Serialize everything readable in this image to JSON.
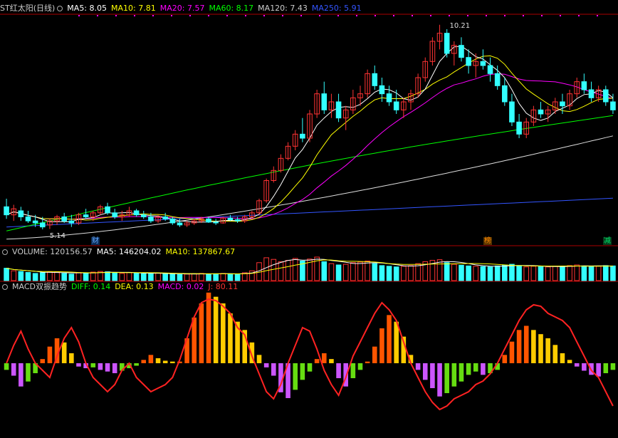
{
  "header": {
    "name": "ST红太阳(日线)",
    "ma": [
      {
        "label": "MA5: 8.05",
        "color": "#ffffff"
      },
      {
        "label": "MA10: 7.81",
        "color": "#ffff00"
      },
      {
        "label": "MA20: 7.57",
        "color": "#ff00ff"
      },
      {
        "label": "MA60: 8.17",
        "color": "#00ff00"
      },
      {
        "label": "MA120: 7.43",
        "color": "#cccccc"
      },
      {
        "label": "MA250: 5.91",
        "color": "#3355ff"
      }
    ]
  },
  "volume_header": {
    "items": [
      {
        "label": "VOLUME: 120156.57",
        "color": "#cccccc"
      },
      {
        "label": "MA5: 146204.02",
        "color": "#ffffff"
      },
      {
        "label": "MA10: 137867.67",
        "color": "#ffff00"
      }
    ]
  },
  "macd_header": {
    "items": [
      {
        "label": "MACD双振趋势",
        "color": "#cccccc"
      },
      {
        "label": "DIFF: 0.14",
        "color": "#00ff00"
      },
      {
        "label": "DEA: 0.13",
        "color": "#ffff00"
      },
      {
        "label": "MACD: 0.02",
        "color": "#ff00ff"
      },
      {
        "label": "J: 80.11",
        "color": "#ff3333"
      }
    ]
  },
  "annotations": {
    "high_label": "10.21",
    "low_label": "5.14",
    "flags": [
      {
        "text": "财",
        "color": "#66aaff",
        "bg": "#0a2a55"
      },
      {
        "text": "榜",
        "color": "#ff8800",
        "bg": "#553300"
      },
      {
        "text": "减",
        "color": "#00dd66",
        "bg": "#063d1c"
      }
    ]
  },
  "colors": {
    "up": "#ff3333",
    "down": "#33ffff",
    "ma5": "#ffffff",
    "ma10": "#ffff00",
    "ma20": "#ff00ff",
    "ma60": "#00ff00",
    "ma120": "#dddddd",
    "ma250": "#3355ff",
    "frame": "#aa0000"
  },
  "chart_data": {
    "type": "candlestick",
    "price_range": [
      5.0,
      10.4
    ],
    "ohlc": [
      [
        5.7,
        5.9,
        5.4,
        5.5
      ],
      [
        5.5,
        5.75,
        5.35,
        5.65
      ],
      [
        5.6,
        5.7,
        5.35,
        5.45
      ],
      [
        5.45,
        5.6,
        5.3,
        5.35
      ],
      [
        5.35,
        5.5,
        5.2,
        5.3
      ],
      [
        5.3,
        5.45,
        5.14,
        5.2
      ],
      [
        5.25,
        5.4,
        5.15,
        5.35
      ],
      [
        5.35,
        5.5,
        5.25,
        5.45
      ],
      [
        5.45,
        5.55,
        5.3,
        5.35
      ],
      [
        5.35,
        5.5,
        5.2,
        5.3
      ],
      [
        5.3,
        5.55,
        5.25,
        5.5
      ],
      [
        5.5,
        5.65,
        5.4,
        5.45
      ],
      [
        5.45,
        5.6,
        5.35,
        5.55
      ],
      [
        5.55,
        5.75,
        5.5,
        5.7
      ],
      [
        5.7,
        5.8,
        5.5,
        5.55
      ],
      [
        5.55,
        5.65,
        5.4,
        5.45
      ],
      [
        5.45,
        5.6,
        5.35,
        5.5
      ],
      [
        5.5,
        5.7,
        5.45,
        5.6
      ],
      [
        5.6,
        5.65,
        5.45,
        5.5
      ],
      [
        5.5,
        5.6,
        5.4,
        5.45
      ],
      [
        5.45,
        5.55,
        5.3,
        5.35
      ],
      [
        5.35,
        5.5,
        5.3,
        5.45
      ],
      [
        5.45,
        5.55,
        5.35,
        5.4
      ],
      [
        5.4,
        5.45,
        5.25,
        5.3
      ],
      [
        5.3,
        5.4,
        5.2,
        5.25
      ],
      [
        5.25,
        5.35,
        5.2,
        5.3
      ],
      [
        5.3,
        5.4,
        5.25,
        5.35
      ],
      [
        5.35,
        5.45,
        5.3,
        5.4
      ],
      [
        5.4,
        5.45,
        5.3,
        5.32
      ],
      [
        5.32,
        5.4,
        5.25,
        5.3
      ],
      [
        5.3,
        5.45,
        5.28,
        5.42
      ],
      [
        5.42,
        5.5,
        5.35,
        5.38
      ],
      [
        5.38,
        5.45,
        5.3,
        5.35
      ],
      [
        5.35,
        5.5,
        5.3,
        5.45
      ],
      [
        5.45,
        5.6,
        5.4,
        5.55
      ],
      [
        5.55,
        5.9,
        5.5,
        5.85
      ],
      [
        5.85,
        6.4,
        5.8,
        6.35
      ],
      [
        6.35,
        6.7,
        6.3,
        6.6
      ],
      [
        6.6,
        7.0,
        6.55,
        6.9
      ],
      [
        6.9,
        7.3,
        6.85,
        7.2
      ],
      [
        7.2,
        7.6,
        7.1,
        7.5
      ],
      [
        7.5,
        7.9,
        7.3,
        7.4
      ],
      [
        7.4,
        8.1,
        7.3,
        8.0
      ],
      [
        8.0,
        8.6,
        7.9,
        8.5
      ],
      [
        8.5,
        8.8,
        8.0,
        8.1
      ],
      [
        8.1,
        8.5,
        7.9,
        8.3
      ],
      [
        8.3,
        8.5,
        7.8,
        7.9
      ],
      [
        7.9,
        8.2,
        7.6,
        8.1
      ],
      [
        8.1,
        8.6,
        8.0,
        8.4
      ],
      [
        8.4,
        8.7,
        8.2,
        8.5
      ],
      [
        8.5,
        9.1,
        8.4,
        9.0
      ],
      [
        9.0,
        9.2,
        8.6,
        8.7
      ],
      [
        8.7,
        8.9,
        8.3,
        8.5
      ],
      [
        8.5,
        8.7,
        8.2,
        8.3
      ],
      [
        8.3,
        8.6,
        8.0,
        8.1
      ],
      [
        8.1,
        8.4,
        7.9,
        8.3
      ],
      [
        8.3,
        8.6,
        8.1,
        8.5
      ],
      [
        8.5,
        9.0,
        8.4,
        8.9
      ],
      [
        8.9,
        9.4,
        8.8,
        9.3
      ],
      [
        9.3,
        9.9,
        9.2,
        9.8
      ],
      [
        9.8,
        10.21,
        9.6,
        10.0
      ],
      [
        10.0,
        10.1,
        9.4,
        9.5
      ],
      [
        9.5,
        9.8,
        9.2,
        9.7
      ],
      [
        9.7,
        9.9,
        9.3,
        9.4
      ],
      [
        9.4,
        9.6,
        9.0,
        9.2
      ],
      [
        9.2,
        9.5,
        8.9,
        9.3
      ],
      [
        9.3,
        9.6,
        9.1,
        9.2
      ],
      [
        9.2,
        9.4,
        8.8,
        9.0
      ],
      [
        9.0,
        9.2,
        8.6,
        8.7
      ],
      [
        8.7,
        8.9,
        8.2,
        8.3
      ],
      [
        8.3,
        8.5,
        7.7,
        7.8
      ],
      [
        7.8,
        8.0,
        7.4,
        7.5
      ],
      [
        7.5,
        7.9,
        7.4,
        7.8
      ],
      [
        7.8,
        8.2,
        7.7,
        8.1
      ],
      [
        8.1,
        8.3,
        7.9,
        8.0
      ],
      [
        8.0,
        8.2,
        7.8,
        8.1
      ],
      [
        8.1,
        8.4,
        8.0,
        8.3
      ],
      [
        8.3,
        8.5,
        8.0,
        8.2
      ],
      [
        8.2,
        8.6,
        8.1,
        8.5
      ],
      [
        8.5,
        8.9,
        8.4,
        8.8
      ],
      [
        8.8,
        9.0,
        8.5,
        8.6
      ],
      [
        8.6,
        8.8,
        8.3,
        8.4
      ],
      [
        8.4,
        8.7,
        8.3,
        8.6
      ],
      [
        8.6,
        8.7,
        8.2,
        8.3
      ],
      [
        8.3,
        8.5,
        8.0,
        8.1
      ]
    ],
    "volume": [
      38,
      30,
      28,
      25,
      22,
      24,
      27,
      26,
      22,
      20,
      25,
      24,
      26,
      28,
      27,
      24,
      22,
      25,
      23,
      21,
      22,
      23,
      21,
      20,
      19,
      20,
      21,
      22,
      20,
      21,
      22,
      21,
      20,
      24,
      30,
      55,
      70,
      65,
      58,
      62,
      68,
      60,
      66,
      72,
      58,
      52,
      48,
      50,
      55,
      57,
      60,
      52,
      46,
      44,
      42,
      44,
      46,
      52,
      58,
      62,
      64,
      55,
      50,
      47,
      45,
      44,
      43,
      42,
      45,
      48,
      50,
      46,
      42,
      44,
      43,
      42,
      44,
      43,
      46,
      48,
      45,
      43,
      44,
      46,
      45
    ],
    "macd_hist": [
      -0.08,
      -0.15,
      -0.28,
      -0.22,
      -0.12,
      0.05,
      0.2,
      0.3,
      0.25,
      0.12,
      -0.04,
      -0.06,
      -0.05,
      -0.08,
      -0.1,
      -0.12,
      -0.09,
      -0.06,
      -0.03,
      0.04,
      0.1,
      0.06,
      0.03,
      0.02,
      0.02,
      0.3,
      0.55,
      0.72,
      0.85,
      0.8,
      0.72,
      0.6,
      0.5,
      0.4,
      0.25,
      0.1,
      -0.05,
      -0.15,
      -0.35,
      -0.42,
      -0.32,
      -0.2,
      -0.1,
      0.05,
      0.12,
      0.05,
      -0.18,
      -0.28,
      -0.18,
      -0.08,
      0.02,
      0.2,
      0.42,
      0.58,
      0.5,
      0.32,
      0.1,
      -0.08,
      -0.2,
      -0.3,
      -0.4,
      -0.36,
      -0.28,
      -0.22,
      -0.14,
      -0.1,
      -0.14,
      -0.12,
      -0.08,
      0.1,
      0.26,
      0.4,
      0.45,
      0.4,
      0.35,
      0.3,
      0.22,
      0.12,
      0.04,
      -0.04,
      -0.09,
      -0.14,
      -0.16,
      -0.12,
      -0.08
    ],
    "j_line": [
      10,
      35,
      55,
      30,
      10,
      0,
      -10,
      20,
      45,
      60,
      40,
      10,
      -10,
      -20,
      -30,
      -20,
      0,
      10,
      -10,
      -20,
      -30,
      -25,
      -20,
      -10,
      15,
      45,
      75,
      95,
      100,
      98,
      90,
      80,
      60,
      50,
      20,
      -5,
      -30,
      -40,
      -20,
      10,
      35,
      60,
      55,
      30,
      0,
      -20,
      -35,
      -10,
      20,
      40,
      60,
      80,
      95,
      85,
      70,
      40,
      10,
      -10,
      -30,
      -45,
      -55,
      -50,
      -40,
      -35,
      -30,
      -20,
      -15,
      -5,
      10,
      30,
      50,
      70,
      85,
      92,
      90,
      80,
      75,
      70,
      60,
      40,
      20,
      0,
      -10,
      -30,
      -50
    ]
  }
}
